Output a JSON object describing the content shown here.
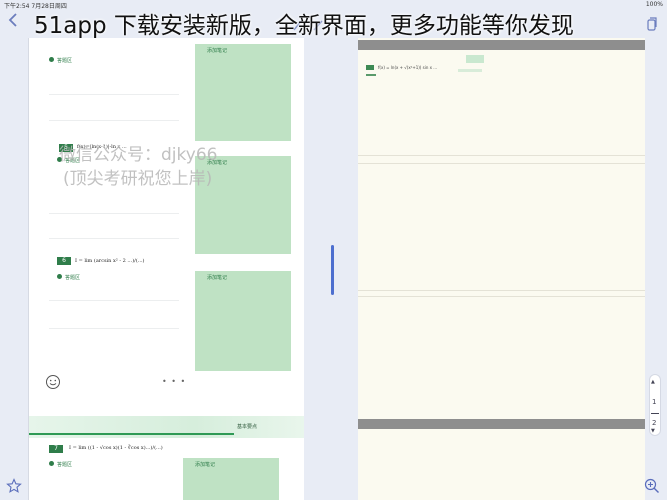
{
  "status_bar": {
    "time": "下午2:54",
    "date": "7月28日周四",
    "right": "100%"
  },
  "title_overlay": "51app 下载安装新版，全新界面，更多功能等你发现",
  "left_page": {
    "problems": [
      {
        "number": "5",
        "formula": "f(x)=|ln(x-1)|-ln x ... ",
        "label": "答题区",
        "note_label": "添加笔记"
      },
      {
        "number": "6",
        "formula": "I = lim (arcsin x² - 2 ...)/(...)",
        "label": "答题区",
        "note_label": "添加笔记"
      },
      {
        "number": "7",
        "formula": "I = lim ((1 - √cos x)(1 - ∛cos x)...)/(...)",
        "label": "答题区",
        "note_label": "添加笔记"
      }
    ],
    "top_label": "答题区",
    "top_note_label": "添加笔记",
    "watermark_line1": "微信公众号：djky66",
    "watermark_line2": "(顶尖考研祝您上岸)",
    "dots": "• • •",
    "section_title": "基本要点"
  },
  "right_page": {
    "problem_number": "1",
    "formula": "f(x) = ln(x + √(x²+1)) sin x ..."
  },
  "page_scroller": {
    "current": "1",
    "total": "2"
  },
  "colors": {
    "accent": "#4d6fcf",
    "green": "#2f7d4a",
    "green_box": "#bfe2c4",
    "right_page_bg": "#fbfaf0"
  },
  "icons": {
    "back": "chevron-left-icon",
    "copy": "copy-icon",
    "pen": "pen-icon",
    "smile": "smile-icon",
    "star": "star-icon",
    "zoom": "zoom-in-icon"
  }
}
